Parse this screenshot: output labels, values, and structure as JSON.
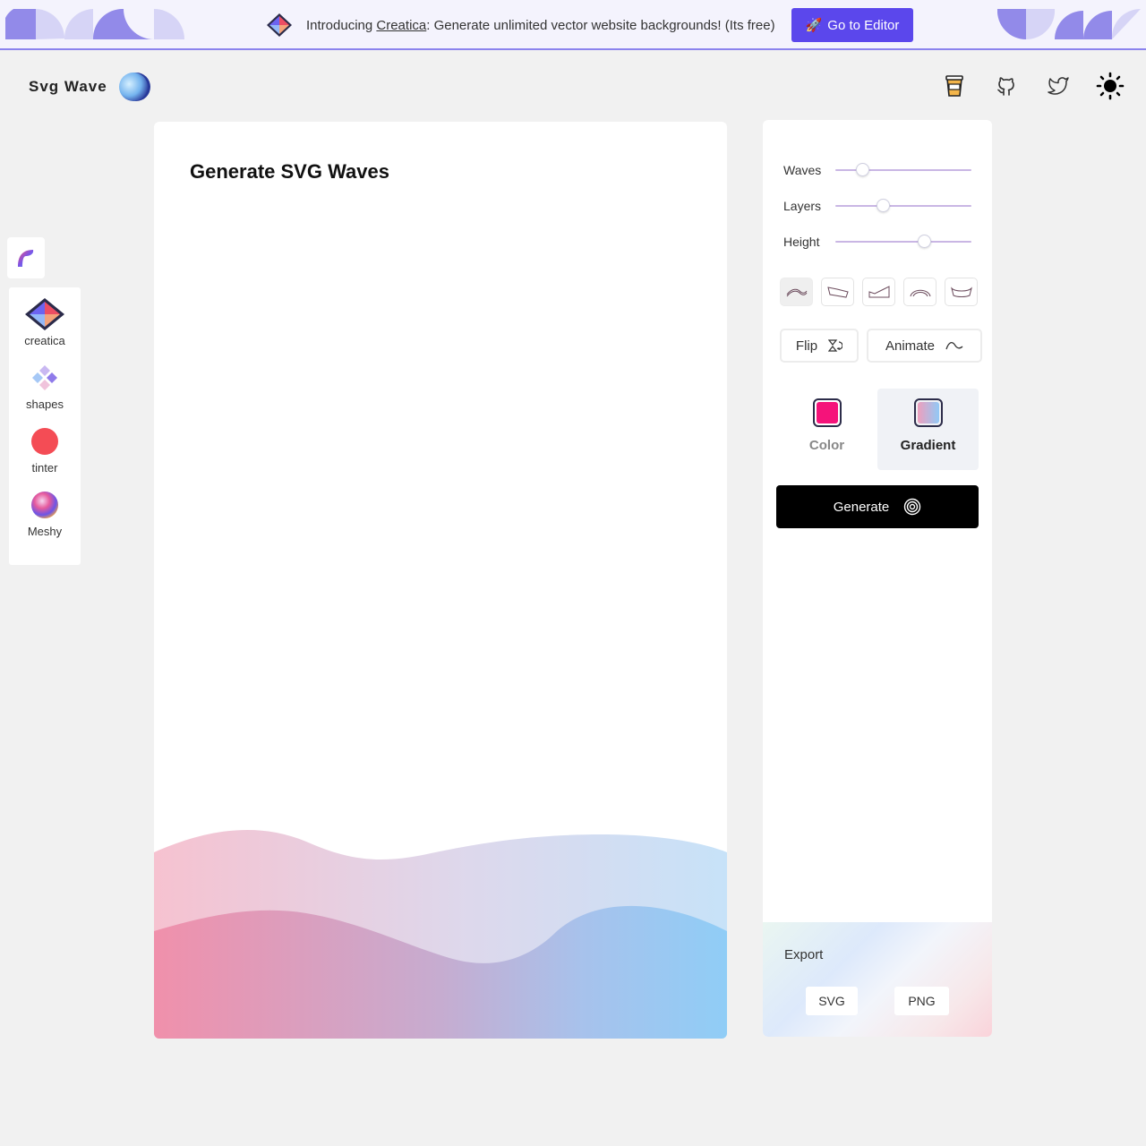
{
  "banner": {
    "intro": "Introducing ",
    "link": "Creatica",
    "rest": ": Generate unlimited vector website backgrounds! (Its free)",
    "cta": "Go to Editor",
    "cta_emoji": "🚀",
    "accent": "#5b47ec"
  },
  "brand": {
    "name": "Svg Wave"
  },
  "header": {
    "icons": [
      "coffee-icon",
      "github-icon",
      "twitter-icon",
      "sun-icon"
    ]
  },
  "sidebar": {
    "items": [
      {
        "label": "creatica",
        "icon": "creatica-icon"
      },
      {
        "label": "shapes",
        "icon": "shapes-icon"
      },
      {
        "label": "tinter",
        "icon": "tinter-icon"
      },
      {
        "label": "Meshy",
        "icon": "meshy-icon"
      }
    ]
  },
  "preview": {
    "title": "Generate SVG Waves"
  },
  "controls": {
    "sliders": [
      {
        "label": "Waves",
        "value": 0.2
      },
      {
        "label": "Layers",
        "value": 0.35
      },
      {
        "label": "Height",
        "value": 0.65
      }
    ],
    "flip_label": "Flip",
    "animate_label": "Animate",
    "fill": {
      "color_label": "Color",
      "gradient_label": "Gradient",
      "color_value": "#f5137a",
      "gradient_from": "#ee9fbd",
      "gradient_to": "#91c9f6"
    },
    "generate_label": "Generate"
  },
  "export": {
    "label": "Export",
    "svg": "SVG",
    "png": "PNG"
  }
}
